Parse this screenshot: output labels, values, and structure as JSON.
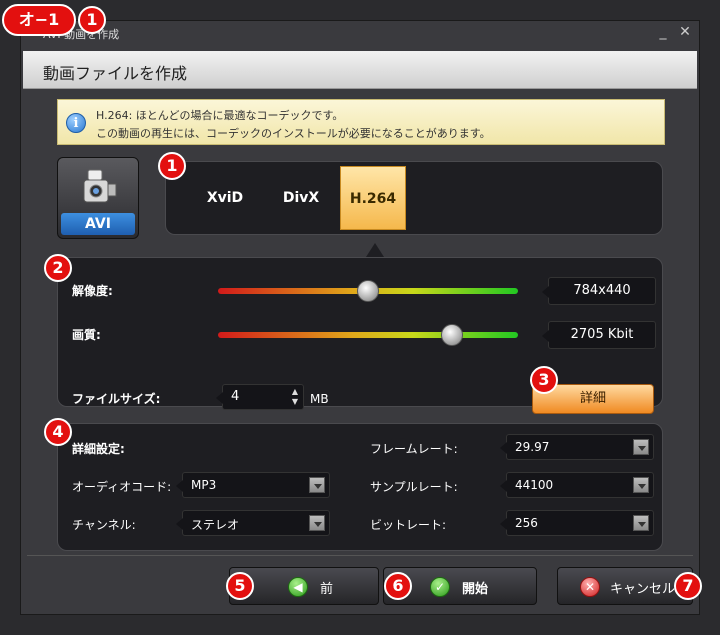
{
  "window": {
    "title": "AVI 動画を作成",
    "minimize_label": "_",
    "close_label": "✕"
  },
  "header": {
    "title": "動画ファイルを作成"
  },
  "info": {
    "line1": "H.264: ほとんどの場合に最適なコーデックです。",
    "line2": "この動画の再生には、コーデックのインストールが必要になることがあります。",
    "icon": "info-icon"
  },
  "format": {
    "label": "AVI",
    "icon": "video-camera-icon"
  },
  "codecs": [
    {
      "label": "XviD",
      "active": false
    },
    {
      "label": "DivX",
      "active": false
    },
    {
      "label": "H.264",
      "active": true
    }
  ],
  "quality": {
    "resolution_label": "解像度:",
    "resolution_value": "784x440",
    "resolution_level": 0.5,
    "quality_label": "画質:",
    "quality_value": "2705 Kbit",
    "quality_level": 0.78,
    "filesize_label": "ファイルサイズ:",
    "filesize_value": "4",
    "filesize_unit": "MB",
    "detail_button": "詳細"
  },
  "advanced": {
    "title": "詳細設定:",
    "audio_codec_label": "オーディオコード:",
    "audio_codec_value": "MP3",
    "channel_label": "チャンネル:",
    "channel_value": "ステレオ",
    "framerate_label": "フレームレート:",
    "framerate_value": "29.97",
    "samplerate_label": "サンプルレート:",
    "samplerate_value": "44100",
    "bitrate_label": "ビットレート:",
    "bitrate_value": "256"
  },
  "footer": {
    "back_label": "前",
    "start_label": "開始",
    "cancel_label": "キャンセル"
  },
  "annotations": {
    "tag": "オ−1",
    "n1": "1",
    "n2": "2",
    "n3": "3",
    "n4": "4",
    "n5": "5",
    "n6": "6",
    "n7": "7"
  },
  "colors": {
    "accent_orange": "#f5b84c",
    "annotation_red": "#e3100f",
    "info_bg": "#f1e6a9"
  }
}
